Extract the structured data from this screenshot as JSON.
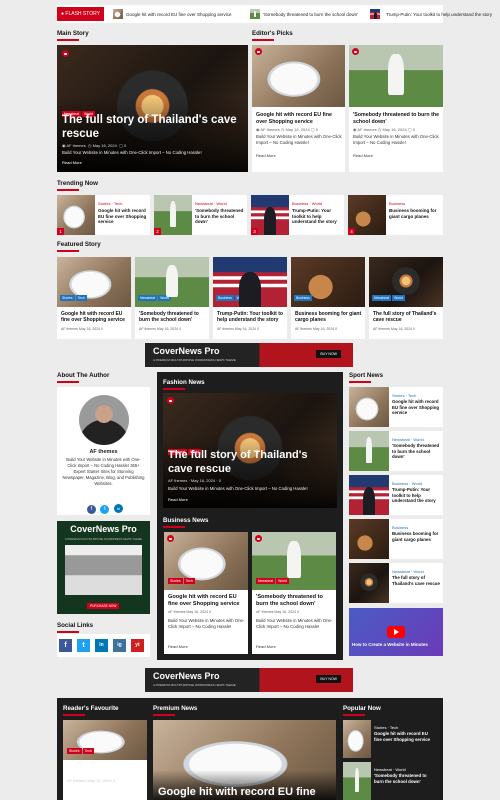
{
  "ticker": {
    "label": "FLASH STORY",
    "items": [
      "Google hit with record EU fine over Shopping service",
      "'Somebody threatened to burn the school down'",
      "Trump-Putin: Your toolkit to help understand the story"
    ]
  },
  "main_story": {
    "heading": "Main Story",
    "tags": [
      "Newsbeat",
      "World"
    ],
    "title": "The full story of Thailand's cave rescue",
    "author": "AF themes",
    "date": "May 16, 2024",
    "comments": "0",
    "excerpt": "Build Your Website in Minutes with One-Click Import – No Coding Hassle!",
    "read_more": "Read More"
  },
  "editors_picks": {
    "heading": "Editor's Picks",
    "items": [
      {
        "title": "Google hit with record EU fine over Shopping service",
        "author": "AF themes",
        "date": "May 16, 2024",
        "comments": "0",
        "excerpt": "Build Your Website in Minutes with One-Click Import – No Coding Hassle!",
        "read_more": "Read More"
      },
      {
        "title": "'Somebody threatened to burn the school down'",
        "author": "AF themes",
        "date": "May 16, 2024",
        "comments": "0",
        "excerpt": "Build Your Website in Minutes with One-Click Import – No Coding Hassle!",
        "read_more": "Read More"
      }
    ]
  },
  "trending": {
    "heading": "Trending Now",
    "items": [
      {
        "num": "1",
        "cats": "Stories · Tech",
        "title": "Google hit with record EU fine over Shopping service"
      },
      {
        "num": "2",
        "cats": "Newsbeat · World",
        "title": "'Somebody threatened to burn the school down'"
      },
      {
        "num": "3",
        "cats": "Business · World",
        "title": "Trump-Putin: Your toolkit to help understand the story"
      },
      {
        "num": "4",
        "cats": "Business",
        "title": "Business booming for giant cargo planes"
      }
    ]
  },
  "featured": {
    "heading": "Featured Story",
    "items": [
      {
        "tags": [
          "Stories",
          "Tech"
        ],
        "title": "Google hit with record EU fine over Shopping service",
        "author": "AF themes",
        "date": "May 16, 2024",
        "comments": "0"
      },
      {
        "tags": [
          "Newsbeat",
          "World"
        ],
        "title": "'Somebody threatened to burn the school down'",
        "author": "AF themes",
        "date": "May 16, 2024",
        "comments": "0"
      },
      {
        "tags": [
          "Business",
          "World"
        ],
        "title": "Trump-Putin: Your toolkit to help understand the story",
        "author": "AF themes",
        "date": "May 16, 2024",
        "comments": "0"
      },
      {
        "tags": [
          "Business"
        ],
        "title": "Business booming for giant cargo planes",
        "author": "AF themes",
        "date": "May 16, 2024",
        "comments": "0"
      },
      {
        "tags": [
          "Newsbeat",
          "World"
        ],
        "title": "The full story of Thailand's cave rescue",
        "author": "AF themes",
        "date": "May 16, 2024",
        "comments": "0"
      }
    ]
  },
  "ad": {
    "title": "CoverNews Pro",
    "subtitle": "A PREMIUM MULTIPURPOSE WORDPRESS NEWS THEME",
    "button": "BUY NOW"
  },
  "author_box": {
    "heading": "About The Author",
    "name": "AF themes",
    "bio": "Build Your Website in Minutes with One-Click Import – No Coding Hassle! 365+ Expert Starter Sites for Stunning Newspaper, Magazine, Blog, and Publishing Websites."
  },
  "side_ad": {
    "title": "CoverNews Pro",
    "subtitle": "A PREMIUM MULTIPURPOSE WORDPRESS NEWS THEME",
    "button": "PURCHASE NOW"
  },
  "social": {
    "heading": "Social Links",
    "icons": [
      "f",
      "t",
      "in",
      "ig",
      "yt"
    ]
  },
  "fashion": {
    "heading": "Fashion News",
    "tags": [
      "Newsbeat",
      "World"
    ],
    "title": "The full story of Thailand's cave rescue",
    "author": "AF themes",
    "date": "May 16, 2024",
    "comments": "0",
    "excerpt": "Build Your Website in Minutes with One-Click Import – No Coding Hassle!",
    "read_more": "Read More"
  },
  "business": {
    "heading": "Business News",
    "items": [
      {
        "tags": [
          "Stories",
          "Tech"
        ],
        "title": "Google hit with record EU fine over Shopping service",
        "author": "AF themes",
        "date": "May 16, 2024",
        "comments": "0",
        "excerpt": "Build Your Website in Minutes with One-Click Import – No Coding Hassle!",
        "read_more": "Read More"
      },
      {
        "tags": [
          "Newsbeat",
          "World"
        ],
        "title": "'Somebody threatened to burn the school down'",
        "author": "AF themes",
        "date": "May 16, 2024",
        "comments": "0",
        "excerpt": "Build Your Website in Minutes with One-Click Import – No Coding Hassle!",
        "read_more": "Read More"
      }
    ]
  },
  "sport": {
    "heading": "Sport News",
    "items": [
      {
        "cats": "Stories · Tech",
        "title": "Google hit with record EU fine over Shopping service"
      },
      {
        "cats": "Newsbeat · World",
        "title": "'Somebody threatened to burn the school down'"
      },
      {
        "cats": "Business · World",
        "title": "Trump-Putin: Your toolkit to help understand the story"
      },
      {
        "cats": "Business",
        "title": "Business booming for giant cargo planes"
      },
      {
        "cats": "Newsbeat · World",
        "title": "The full story of Thailand's cave rescue"
      }
    ],
    "video_title": "How to Create a Website in Minutes"
  },
  "bottom": {
    "readers": "Reader's Favourite",
    "premium": "Premium News",
    "popular": "Popular Now",
    "reader_item": {
      "tags": [
        "Stories",
        "Tech"
      ],
      "title": "Google hit with record EU fine over Shopping service",
      "author": "AF themes",
      "date": "May 16, 2024",
      "comments": "0"
    },
    "premium_title": "Google hit with record EU fine over",
    "popular_items": [
      {
        "cats": "Stories · Tech",
        "title": "Google hit with record EU fine over Shopping service"
      },
      {
        "cats": "Newsbeat · World",
        "title": "'Somebody threatened to burn the school down'"
      }
    ]
  }
}
